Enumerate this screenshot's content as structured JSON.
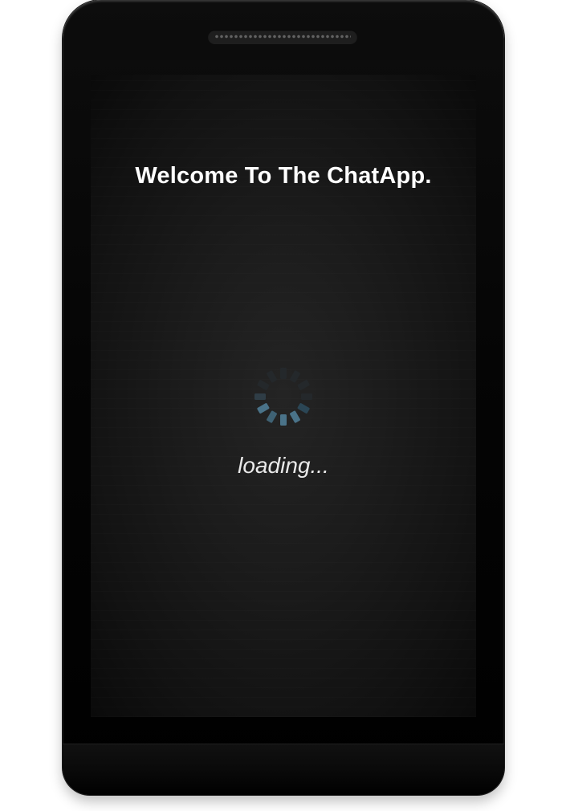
{
  "screen": {
    "welcome_text": "Welcome To The ChatApp.",
    "loading_text": "loading..."
  },
  "spinner": {
    "icon": "loading-spinner-icon",
    "active_color": "#4a7389",
    "inactive_color": "#24282b"
  }
}
